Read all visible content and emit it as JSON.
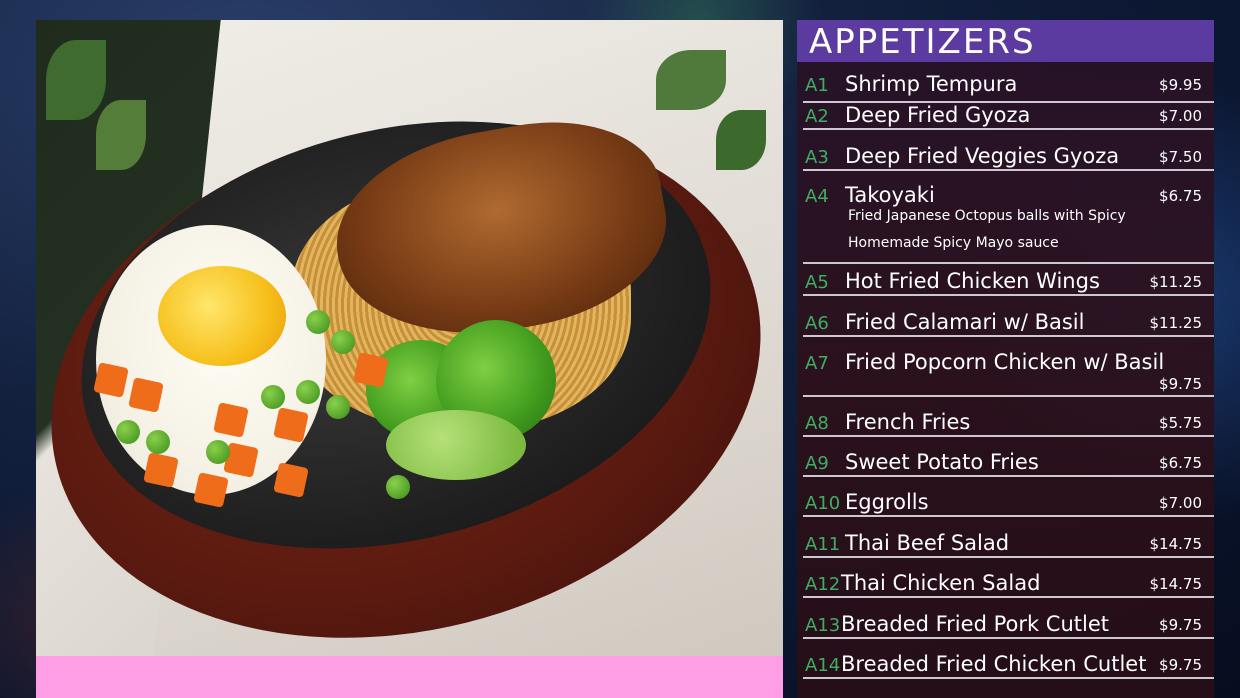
{
  "menu": {
    "title": "APPETIZERS",
    "items": [
      {
        "code": "A1",
        "name": "Shrimp Tempura",
        "price": "$9.95",
        "desc": ""
      },
      {
        "code": "A2",
        "name": "Deep Fried Gyoza",
        "price": "$7.00",
        "desc": ""
      },
      {
        "code": "A3",
        "name": "Deep Fried Veggies Gyoza",
        "price": "$7.50",
        "desc": ""
      },
      {
        "code": "A4",
        "name": "Takoyaki",
        "price": "$6.75",
        "desc1": "Fried Japanese Octopus balls with Spicy",
        "desc2": "Homemade Spicy Mayo sauce"
      },
      {
        "code": "A5",
        "name": "Hot Fried Chicken Wings",
        "price": "$11.25",
        "desc": ""
      },
      {
        "code": "A6",
        "name": "Fried Calamari w/ Basil",
        "price": "$11.25",
        "desc": ""
      },
      {
        "code": "A7",
        "name": "Fried Popcorn Chicken w/ Basil",
        "price": "$9.75",
        "desc": ""
      },
      {
        "code": "A8",
        "name": "French Fries",
        "price": "$5.75",
        "desc": ""
      },
      {
        "code": "A9",
        "name": "Sweet Potato Fries",
        "price": "$6.75",
        "desc": ""
      },
      {
        "code": "A10",
        "name": "Eggrolls",
        "price": "$7.00",
        "desc": ""
      },
      {
        "code": "A11",
        "name": "Thai Beef Salad",
        "price": "$14.75",
        "desc": ""
      },
      {
        "code": "A12",
        "name": "Thai Chicken Salad",
        "price": "$14.75",
        "desc": ""
      },
      {
        "code": "A13",
        "name": "Breaded Fried Pork Cutlet",
        "price": "$9.75",
        "desc": ""
      },
      {
        "code": "A14",
        "name": "Breaded Fried Chicken Cutlet",
        "price": "$9.75",
        "desc": ""
      }
    ]
  },
  "colors": {
    "header": "#5b3ba0",
    "code": "#3fae62",
    "pink_bar": "#ff9ee5"
  }
}
